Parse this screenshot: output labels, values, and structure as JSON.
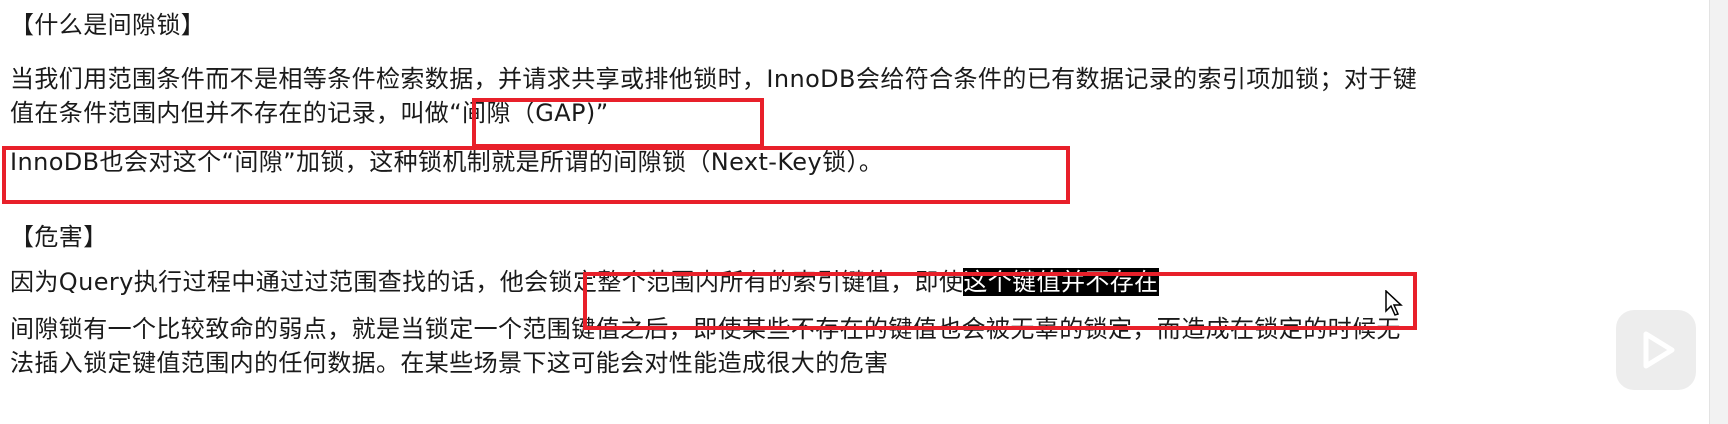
{
  "section1": {
    "heading": "【什么是间隙锁】",
    "line1": "当我们用范围条件而不是相等条件检索数据，并请求共享或排他锁时，InnoDB会给符合条件的已有数据记录的索引项加锁；对于键",
    "line2_part1": "值在条件范围内但并不存在的记录，",
    "line2_part2": "叫做“间隙（GAP)”",
    "line3": "InnoDB也会对这个“间隙”加锁，这种锁机制就是所谓的间隙锁（Next-Key锁）。"
  },
  "section2": {
    "heading": "【危害】",
    "line1_part1": "因为Query执行过程中通过过范围查找的话，",
    "line1_part2": "他会锁定整个范围内所有的索引键值，即使",
    "line1_selected": "这个键值并不存在",
    "line2": "间隙锁有一个比较致命的弱点，就是当锁定一个范围键值之后，即使某些不存在的键值也会被无辜的锁定，而造成在锁定的时候无",
    "line3": "法插入锁定键值范围内的任何数据。在某些场景下这可能会对性能造成很大的危害"
  },
  "colors": {
    "highlight_box": "#e8202a",
    "selection_bg": "#000000",
    "text": "#1a1a1a"
  },
  "icons": {
    "play": "play-icon",
    "cursor": "mouse-pointer-icon"
  }
}
